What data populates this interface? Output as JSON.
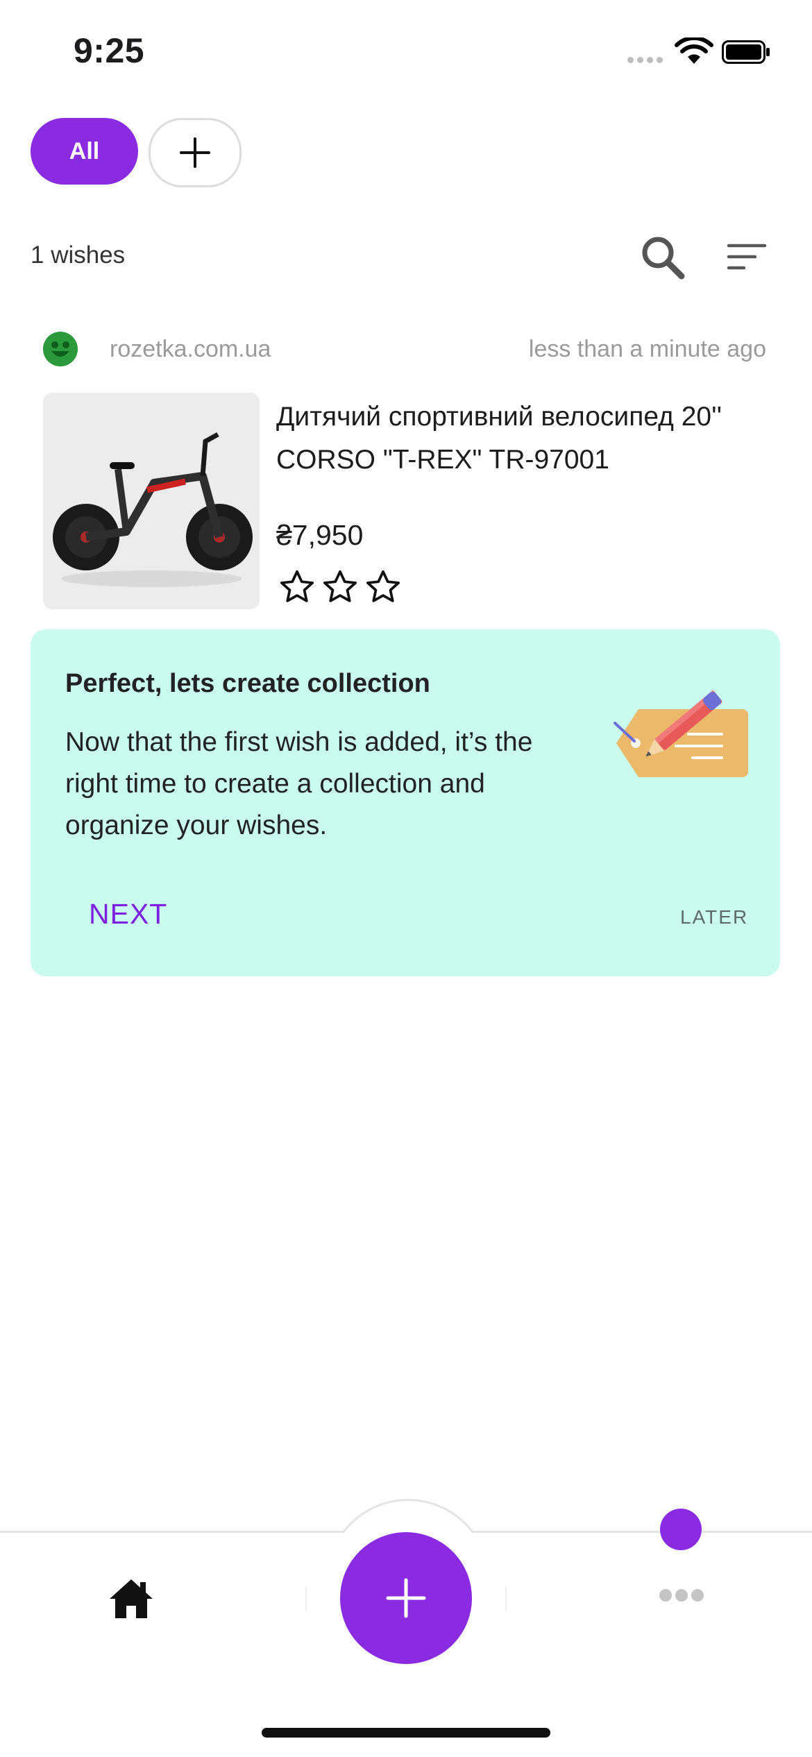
{
  "status_bar": {
    "time": "9:25"
  },
  "filters": {
    "all_label": "All"
  },
  "list_header": {
    "count_label": "1 wishes"
  },
  "wish": {
    "store": "rozetka.com.ua",
    "added": "less than a minute ago",
    "title": "Дитячий спортивний велосипед 20'' CORSO \"T-REX\" TR-97001",
    "price": "₴7,950",
    "rating": 0,
    "rating_max": 3
  },
  "onboarding": {
    "title": "Perfect, lets create collection",
    "text": "Now that the first wish is added, it’s the right time to create a collection and organize your wishes.",
    "next_label": "NEXT",
    "later_label": "LATER"
  },
  "colors": {
    "accent": "#8a2be2",
    "card_bg": "#c9fbee",
    "next_text": "#7c1fe0"
  },
  "icons": [
    "wifi-icon",
    "battery-icon",
    "plus-icon",
    "search-icon",
    "sort-icon",
    "star-outline-icon",
    "home-icon",
    "more-icon"
  ]
}
